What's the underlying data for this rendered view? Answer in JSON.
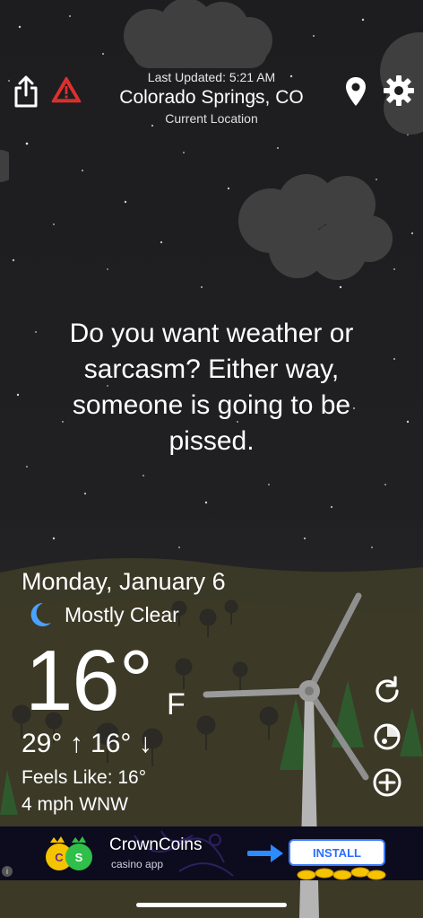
{
  "header": {
    "last_updated": "Last Updated: 5:21 AM",
    "city": "Colorado Springs, CO",
    "location_label": "Current Location"
  },
  "toolbar": {
    "share_icon": "share-icon",
    "alert_icon": "warning-triangle-icon",
    "location_icon": "map-pin-icon",
    "settings_icon": "gear-icon"
  },
  "quote": {
    "text": "Do you want weather or sarcasm? Either way, someone is going to be pissed."
  },
  "weather": {
    "date": "Monday, January 6",
    "condition": "Mostly Clear",
    "condition_icon": "crescent-moon-icon",
    "temperature": "16°",
    "unit": "F",
    "high_low": "29° ↑  16° ↓",
    "feels_like": "Feels Like: 16°",
    "wind": "4 mph WNW"
  },
  "side_actions": {
    "refresh_icon": "refresh-icon",
    "radar_icon": "radar-icon",
    "add_icon": "plus-circle-icon"
  },
  "ad": {
    "title": "CrownCoins",
    "subtitle": "casino app",
    "cta": "INSTALL",
    "info": "i"
  },
  "colors": {
    "sky": "#1d1d1f",
    "ground": "#3a3826",
    "alert_red": "#e0302c",
    "moon_blue": "#4aa3ff",
    "ad_background": "#0d0b1e",
    "install_blue": "#2a6dff"
  }
}
